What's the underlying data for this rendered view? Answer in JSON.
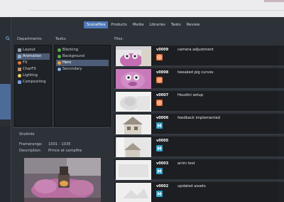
{
  "tabs": [
    {
      "label": "Scenefiles",
      "active": true
    },
    {
      "label": "Products",
      "active": false
    },
    {
      "label": "Media",
      "active": false
    },
    {
      "label": "Libraries",
      "active": false
    },
    {
      "label": "Tasks",
      "active": false
    },
    {
      "label": "Review",
      "active": false
    }
  ],
  "departments": {
    "header": "Departments:",
    "items": [
      {
        "label": "Layout",
        "icon": "layout-icon",
        "color": "#9aa0a8"
      },
      {
        "label": "Animation",
        "icon": "animation-icon",
        "color": "#8fa8c8",
        "selected": true
      },
      {
        "label": "FX",
        "icon": "fx-icon",
        "color": "#e07a3a"
      },
      {
        "label": "CharFX",
        "icon": "charfx-icon",
        "color": "#c0906a"
      },
      {
        "label": "Lighting",
        "icon": "lighting-icon",
        "color": "#f0d060"
      },
      {
        "label": "Compositing",
        "icon": "compositing-icon",
        "color": "#7aa0d8"
      }
    ]
  },
  "tasks": {
    "header": "Tasks:",
    "items": [
      {
        "label": "Blocking",
        "status_color": "#5ab04a"
      },
      {
        "label": "Background",
        "status_color": "#5ab04a"
      },
      {
        "label": "Hero",
        "status_color": "#e8a03a",
        "selected": true
      },
      {
        "label": "Secondary",
        "status_color": "#7fb0e0"
      }
    ]
  },
  "files": {
    "header": "Files:",
    "rows": [
      {
        "version": "v0009",
        "comment": "camera adjustment",
        "app": "houdini-icon",
        "thumb": "pink"
      },
      {
        "version": "v0008",
        "comment": "tweaked pig curves",
        "app": "houdini-icon",
        "thumb": "pink2"
      },
      {
        "version": "v0007",
        "comment": "Houdini setup",
        "app": "houdini-icon",
        "thumb": "white"
      },
      {
        "version": "v0006",
        "comment": "feedback implemented",
        "app": "maya-icon",
        "thumb": "house"
      },
      {
        "version": "v0005",
        "comment": "",
        "app": "maya-icon",
        "thumb": "house2"
      },
      {
        "version": "v0003",
        "comment": "anim test",
        "app": "maya-icon",
        "thumb": "white2"
      },
      {
        "version": "v0002",
        "comment": "updated assets",
        "app": "maya-icon",
        "thumb": "white3"
      }
    ]
  },
  "shotinfo": {
    "header": "ShotInfo",
    "framerange_label": "Framerange:",
    "framerange_value": "1001 - 1035",
    "description_label": "Description:",
    "description_value": "Prince at campfire"
  },
  "colors": {
    "accent": "#4f78b8",
    "houdini": "#e86a2a",
    "maya": "#2aa0c8"
  }
}
